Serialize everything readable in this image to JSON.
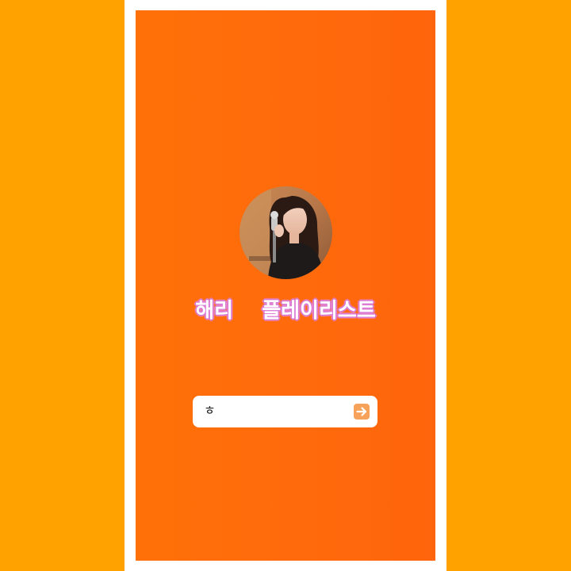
{
  "page": {
    "background_color": "#FFA200",
    "screen_color": "#FF6A0A"
  },
  "profile": {
    "avatar_icon": "profile-photo-singer-at-microphone"
  },
  "title": {
    "text": "해리    플레이리스트",
    "glow_color": "#E080D8"
  },
  "search": {
    "value": "ㅎ",
    "submit_icon": "arrow-right-icon",
    "submit_color": "#F7A25A"
  }
}
